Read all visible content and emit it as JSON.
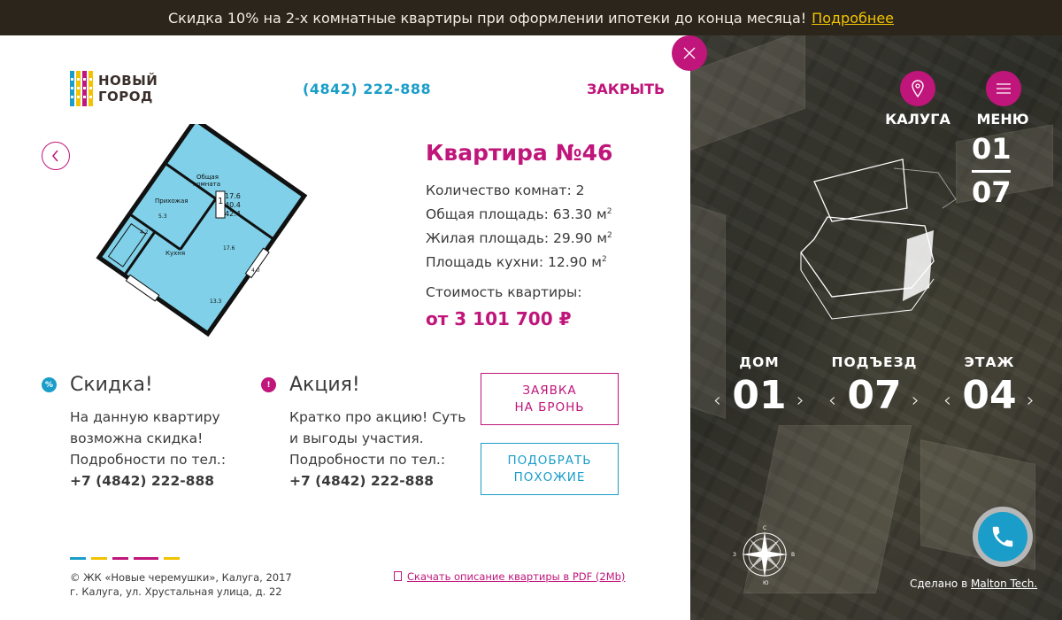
{
  "promo_bar": {
    "text": "Скидка 10% на 2-х комнатные квартиры при оформлении ипотеки до конца месяца!",
    "link": "Подробнее",
    "stripe_colors": [
      "#1a9dc9",
      "#f2c300",
      "#c0157a",
      "#ffffff"
    ]
  },
  "header": {
    "logo_line1": "НОВЫЙ",
    "logo_line2": "ГОРОД",
    "phone": "(4842) 222-888",
    "close_label": "ЗАКРЫТЬ"
  },
  "apartment": {
    "title": "Квартира №46",
    "rooms": "Количество комнат: 2",
    "total_area": "Общая площадь: 63.30 м",
    "living_area": "Жилая площадь: 29.90 м",
    "kitchen_area": "Площадь кухни: 12.90 м",
    "sq": "2",
    "price_label": "Стоимость квартиры:",
    "price": "от 3 101 700 ₽"
  },
  "plan": {
    "room_general": "Общая",
    "room_general2": "комната",
    "hall": "Прихожая",
    "kitchen": "Кухня",
    "v1": "17.6",
    "v2": "40.4",
    "v3": "42.4",
    "v_room": "1",
    "a_53": "5.3",
    "a_42": "4.2",
    "a_176": "17.6",
    "a_40": "4.0",
    "a_133": "13.3"
  },
  "discount": {
    "icon_text": "%",
    "title": "Скидка!",
    "lines": [
      "На данную квартиру",
      "возможна скидка!",
      "Подробности по тел.:"
    ],
    "phone": "+7 (4842) 222-888"
  },
  "action": {
    "icon_text": "!",
    "title": "Акция!",
    "lines": [
      "Кратко про акцию! Суть",
      "и выгоды участия.",
      "Подробности по тел.:"
    ],
    "phone": "+7 (4842) 222-888"
  },
  "buttons": {
    "book_line1": "ЗАЯВКА",
    "book_line2": "НА БРОНЬ",
    "similar_line1": "ПОДОБРАТЬ",
    "similar_line2": "ПОХОЖИЕ"
  },
  "footer": {
    "copyright1": "© ЖК «Новые черемушки», Калуга, 2017",
    "copyright2": "г. Калуга, ул. Хрустальная улица, д. 22",
    "pdf_link": "Скачать описание квартиры в PDF (2Mb)",
    "line_colors": [
      "#1a9dc9",
      "#f2c300",
      "#c0157a",
      "#c0157a",
      "#f2c300"
    ]
  },
  "right_panel": {
    "city_label": "КАЛУГА",
    "menu_label": "МЕНЮ",
    "counter_top": "01",
    "counter_bottom": "07",
    "selectors": [
      {
        "label": "ДОМ",
        "value": "01"
      },
      {
        "label": "ПОДЪЕЗД",
        "value": "07"
      },
      {
        "label": "ЭТАЖ",
        "value": "04"
      }
    ],
    "compass": {
      "n": "С",
      "s": "Ю",
      "e": "В",
      "w": "З"
    },
    "made_by_prefix": "Сделано в",
    "made_by_link": "Malton Tech."
  },
  "colors": {
    "accent_magenta": "#c0157a",
    "accent_blue": "#1a9dc9",
    "accent_yellow": "#f2c300",
    "promo_bg": "#2c251b"
  },
  "icons": [
    "close-icon",
    "chevron-left-icon",
    "location-pin-icon",
    "hamburger-menu-icon",
    "phone-icon",
    "pdf-icon",
    "compass-icon",
    "percent-icon",
    "exclamation-icon"
  ]
}
